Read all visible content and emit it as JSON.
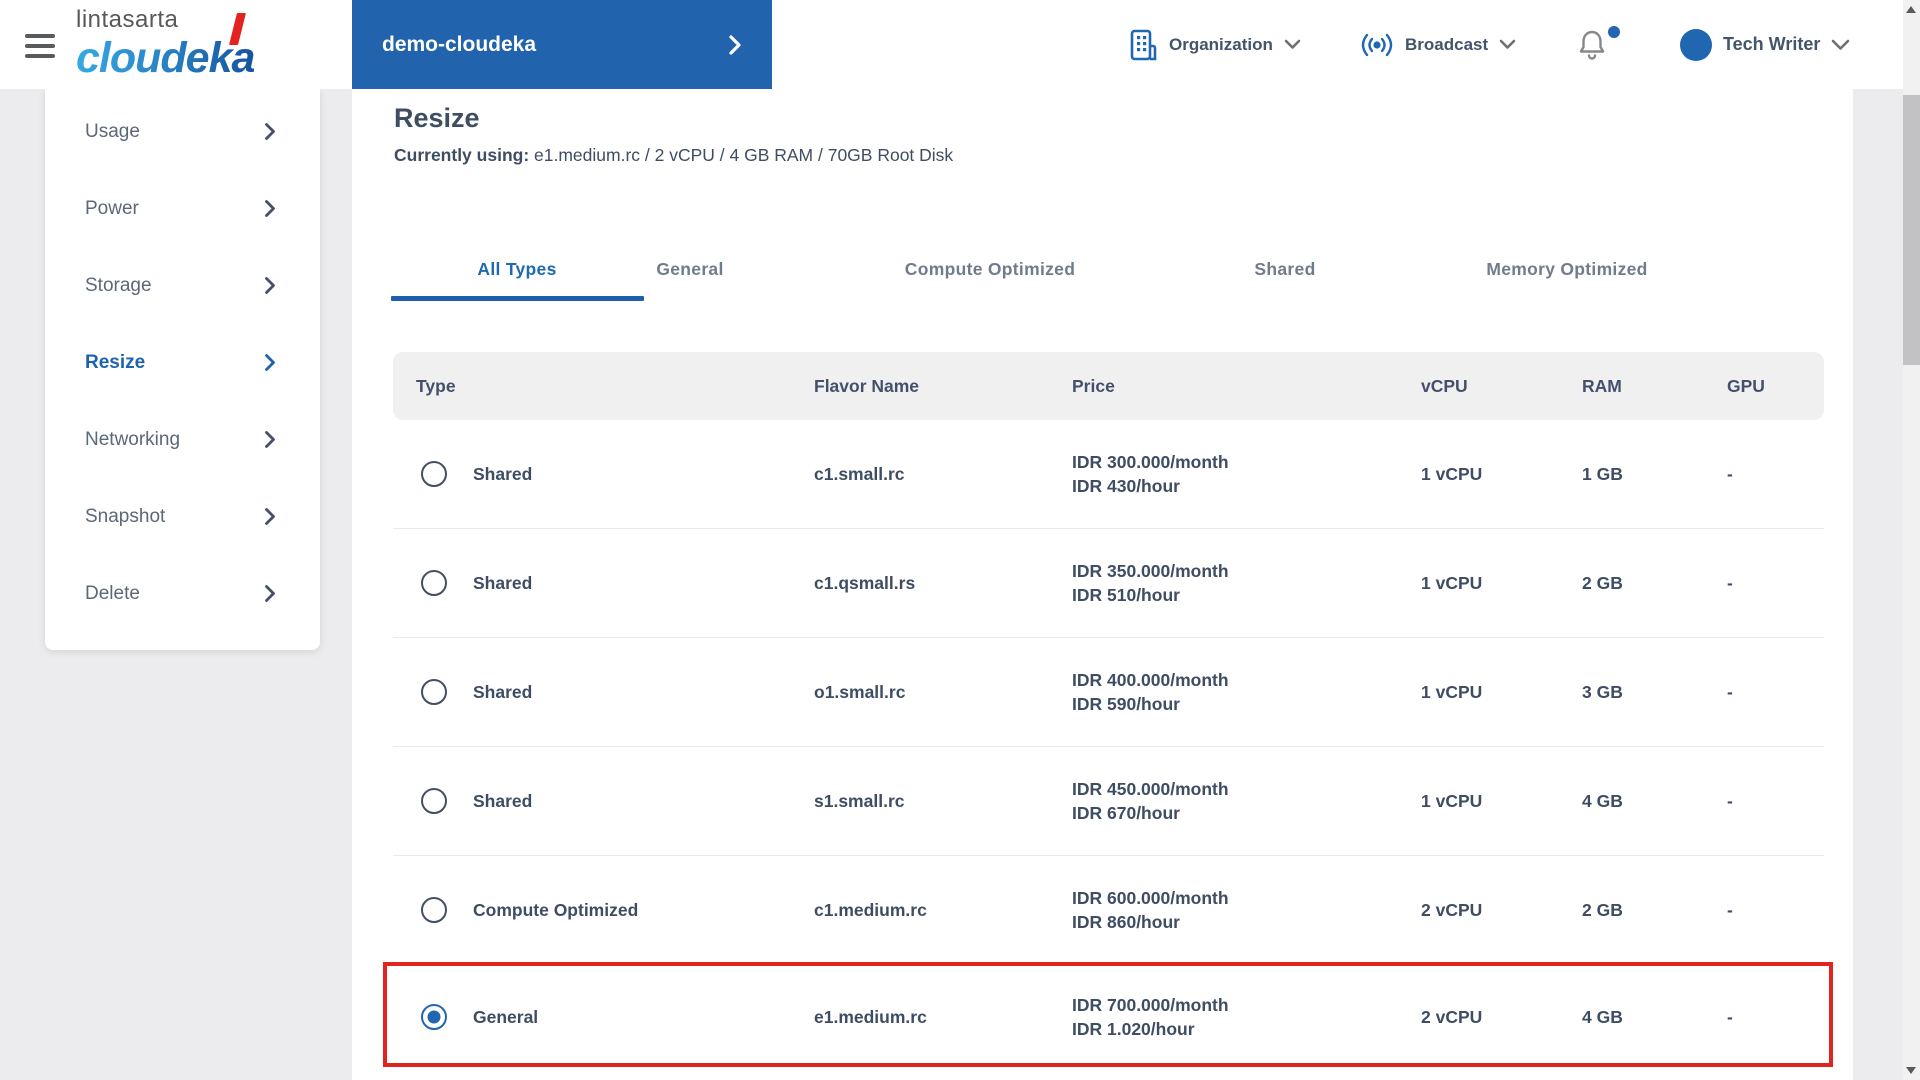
{
  "brand": {
    "company": "lintasarta",
    "product_left": "cloude",
    "product_right": "ka"
  },
  "header": {
    "project_button": {
      "label": "demo-cloudeka"
    },
    "organization_label": "Organization",
    "broadcast_label": "Broadcast",
    "user": {
      "name": "Tech Writer"
    }
  },
  "sidebar": {
    "items": [
      {
        "label": "Usage",
        "active": false
      },
      {
        "label": "Power",
        "active": false
      },
      {
        "label": "Storage",
        "active": false
      },
      {
        "label": "Resize",
        "active": true
      },
      {
        "label": "Networking",
        "active": false
      },
      {
        "label": "Snapshot",
        "active": false
      },
      {
        "label": "Delete",
        "active": false
      }
    ]
  },
  "main": {
    "title": "Resize",
    "current": {
      "label": "Currently using:",
      "value": " e1.medium.rc / 2 vCPU / 4 GB RAM / 70GB Root Disk"
    },
    "tabs": [
      {
        "label": "All Types",
        "active": true
      },
      {
        "label": "General",
        "active": false
      },
      {
        "label": "Compute Optimized",
        "active": false
      },
      {
        "label": "Shared",
        "active": false
      },
      {
        "label": "Memory Optimized",
        "active": false
      }
    ],
    "table": {
      "columns": [
        "Type",
        "Flavor Name",
        "Price",
        "vCPU",
        "RAM",
        "GPU"
      ],
      "rows": [
        {
          "type": "Shared",
          "flavor": "c1.small.rc",
          "price_month": "IDR 300.000/month",
          "price_hour": "IDR 430/hour",
          "vcpu": "1 vCPU",
          "ram": "1 GB",
          "gpu": "-",
          "selected": false
        },
        {
          "type": "Shared",
          "flavor": "c1.qsmall.rs",
          "price_month": "IDR 350.000/month",
          "price_hour": "IDR 510/hour",
          "vcpu": "1 vCPU",
          "ram": "2 GB",
          "gpu": "-",
          "selected": false
        },
        {
          "type": "Shared",
          "flavor": "o1.small.rc",
          "price_month": "IDR 400.000/month",
          "price_hour": "IDR 590/hour",
          "vcpu": "1 vCPU",
          "ram": "3 GB",
          "gpu": "-",
          "selected": false
        },
        {
          "type": "Shared",
          "flavor": "s1.small.rc",
          "price_month": "IDR 450.000/month",
          "price_hour": "IDR 670/hour",
          "vcpu": "1 vCPU",
          "ram": "4 GB",
          "gpu": "-",
          "selected": false
        },
        {
          "type": "Compute Optimized",
          "flavor": "c1.medium.rc",
          "price_month": "IDR 600.000/month",
          "price_hour": "IDR 860/hour",
          "vcpu": "2 vCPU",
          "ram": "2 GB",
          "gpu": "-",
          "selected": false
        },
        {
          "type": "General",
          "flavor": "e1.medium.rc",
          "price_month": "IDR 700.000/month",
          "price_hour": "IDR 1.020/hour",
          "vcpu": "2 vCPU",
          "ram": "4 GB",
          "gpu": "-",
          "selected": true
        }
      ]
    }
  },
  "colors": {
    "brand_blue": "#2263ae",
    "icon_blue": "#2166b1",
    "active_blue": "#1e63ad",
    "highlight_red": "#e2231f",
    "text_dark": "#3f4d63",
    "page_background": "#ececee"
  }
}
